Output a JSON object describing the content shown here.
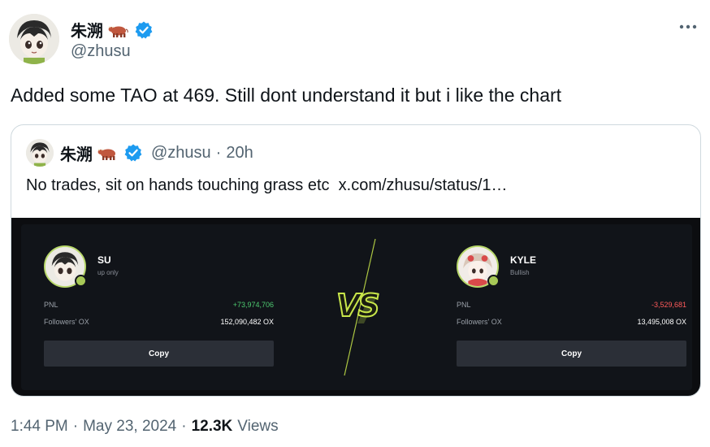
{
  "author": {
    "name": "朱溯",
    "handle": "@zhusu"
  },
  "more_icon": "more-horizontal-icon",
  "tweet": {
    "text": "Added some TAO at 469. Still dont understand it but i like the chart"
  },
  "quoted": {
    "name": "朱溯",
    "handle": "@zhusu",
    "separator": "·",
    "time": "20h",
    "text": "No trades, sit on hands touching grass etc  x.com/zhusu/status/1…"
  },
  "media": {
    "vs_label": "VS",
    "left": {
      "name": "SU",
      "subtitle": "up only",
      "pnl_label": "PNL",
      "pnl_value": "+73,974,706",
      "followers_label": "Followers' OX",
      "followers_value": "152,090,482 OX",
      "copy_label": "Copy"
    },
    "right": {
      "name": "KYLE",
      "subtitle": "Bullish",
      "pnl_label": "PNL",
      "pnl_value": "-3,529,681",
      "followers_label": "Followers' OX",
      "followers_value": "13,495,008 OX",
      "copy_label": "Copy"
    }
  },
  "footer": {
    "time": "1:44 PM",
    "sep1": "·",
    "date": "May 23, 2024",
    "sep2": "·",
    "views_count": "12.3K",
    "views_label": "Views"
  },
  "colors": {
    "verified": "#1d9bf0",
    "positive": "#4ecb71",
    "negative": "#ff5a5a",
    "accent": "#c8e64a"
  }
}
